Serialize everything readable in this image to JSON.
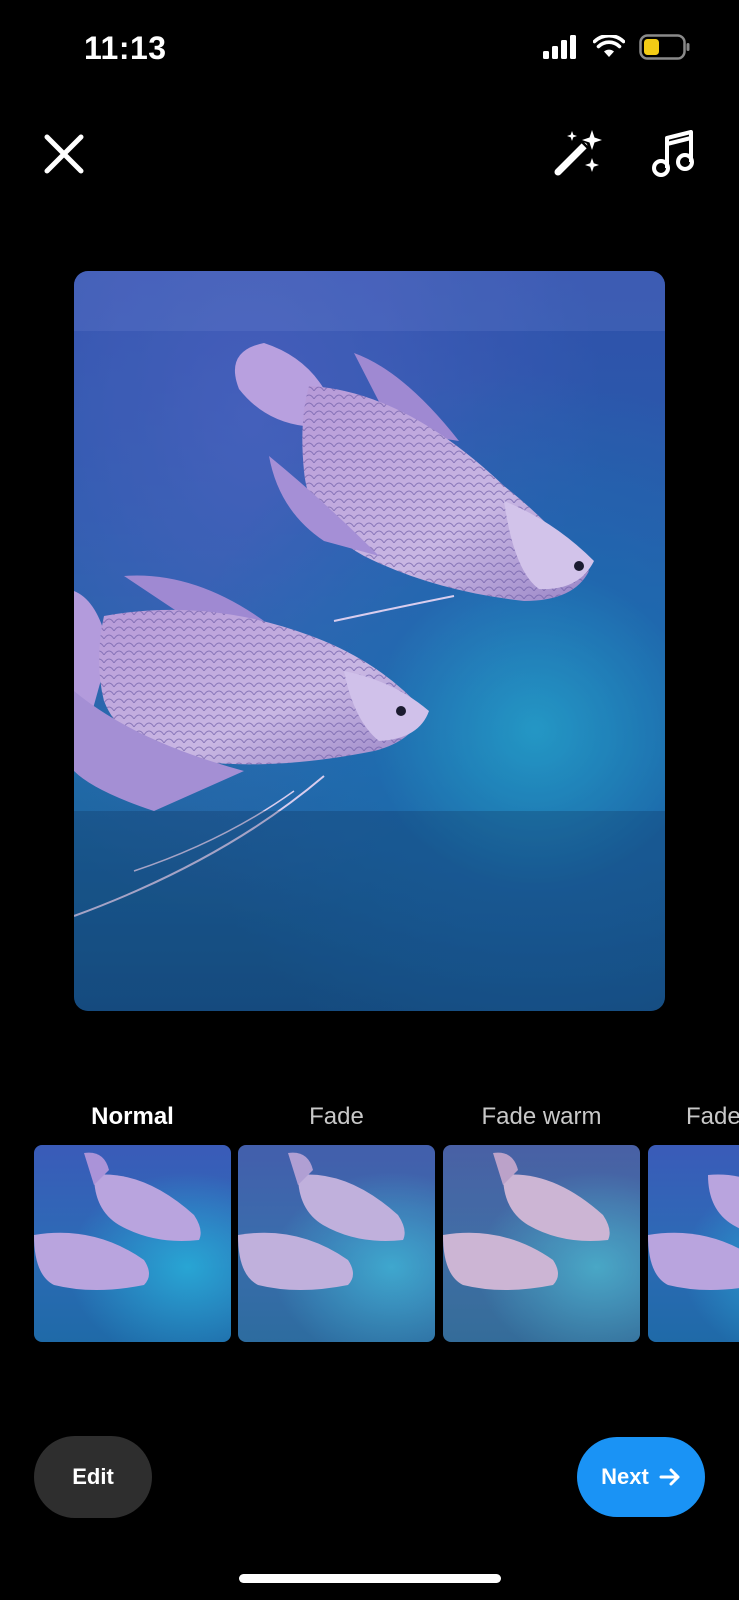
{
  "status_bar": {
    "time": "11:13",
    "icons": [
      "signal-icon",
      "wifi-icon",
      "battery-icon"
    ],
    "battery_color": "#f3cc15"
  },
  "toolbar": {
    "icons": [
      "close-icon",
      "magic-wand-icon",
      "music-note-icon"
    ]
  },
  "preview": {
    "subject": "photo"
  },
  "filters": [
    {
      "label": "Normal",
      "selected": true
    },
    {
      "label": "Fade",
      "selected": false
    },
    {
      "label": "Fade warm",
      "selected": false
    },
    {
      "label": "Fade",
      "selected": false
    }
  ],
  "actions": {
    "edit_label": "Edit",
    "next_label": "Next",
    "next_icon": "arrow-right-icon",
    "next_color": "#1a93f5"
  }
}
